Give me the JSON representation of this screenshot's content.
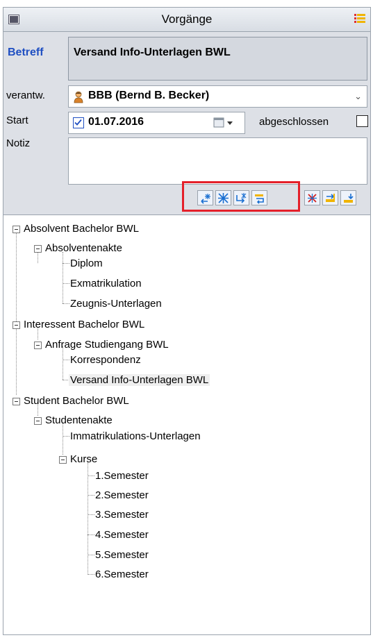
{
  "window": {
    "title": "Vorgänge"
  },
  "form": {
    "betreff_label": "Betreff",
    "betreff_value": "Versand Info-Unterlagen BWL",
    "verantw_label": "verantw.",
    "verantw_value": "BBB (Bernd B. Becker)",
    "start_label": "Start",
    "start_date": "01.07.2016",
    "start_checked": true,
    "abgeschlossen_label": "abgeschlossen",
    "abgeschlossen_checked": false,
    "notiz_label": "Notiz",
    "notiz_value": ""
  },
  "toolbar": {
    "buttons": [
      "insert-before-icon",
      "new-node-icon",
      "insert-child-icon",
      "move-icon",
      "delete-node-icon",
      "move-up-icon",
      "move-down-icon"
    ],
    "highlighted_buttons": 4
  },
  "tree": {
    "nodes": [
      {
        "label": "Absolvent Bachelor BWL"
      },
      {
        "label": "Absolventenakte"
      },
      {
        "label": "Diplom"
      },
      {
        "label": "Exmatrikulation"
      },
      {
        "label": "Zeugnis-Unterlagen"
      },
      {
        "label": "Interessent Bachelor BWL"
      },
      {
        "label": "Anfrage Studiengang BWL"
      },
      {
        "label": "Korrespondenz"
      },
      {
        "label": "Versand Info-Unterlagen BWL"
      },
      {
        "label": "Student Bachelor BWL"
      },
      {
        "label": "Studentenakte"
      },
      {
        "label": "Immatrikulations-Unterlagen"
      },
      {
        "label": "Kurse"
      },
      {
        "label": "1.Semester"
      },
      {
        "label": "2.Semester"
      },
      {
        "label": "3.Semester"
      },
      {
        "label": "4.Semester"
      },
      {
        "label": "5.Semester"
      },
      {
        "label": "6.Semester"
      }
    ],
    "selected": "Versand Info-Unterlagen BWL"
  }
}
